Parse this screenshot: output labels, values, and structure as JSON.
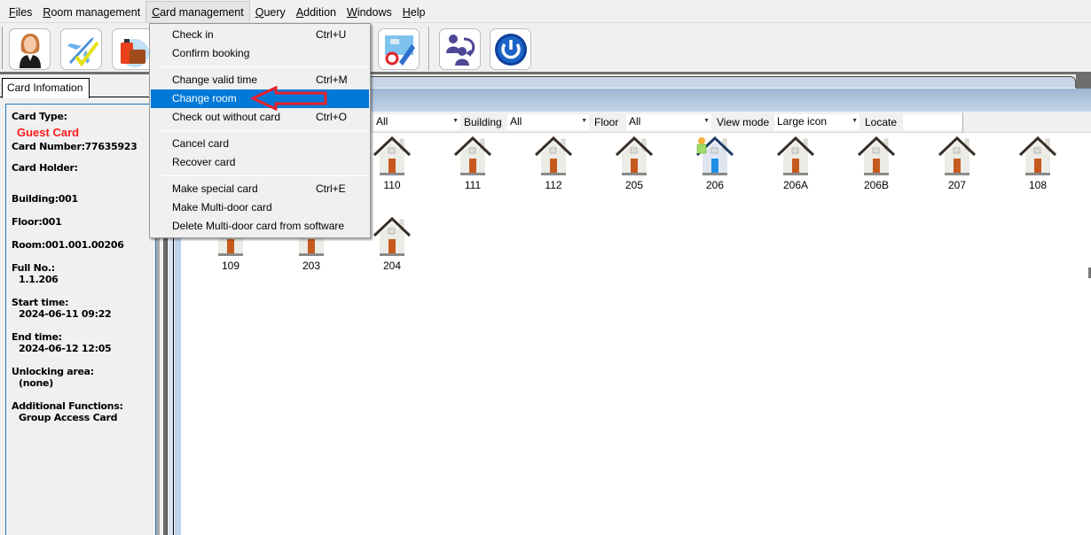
{
  "menubar": {
    "items": [
      {
        "label": "Files",
        "accel": "F",
        "rest": "iles"
      },
      {
        "label": "Room management",
        "accel": "R",
        "rest": "oom management"
      },
      {
        "label": "Card management",
        "accel": "C",
        "rest": "ard management",
        "open": true
      },
      {
        "label": "Query",
        "accel": "Q",
        "rest": "uery"
      },
      {
        "label": "Addition",
        "accel": "A",
        "rest": "ddition"
      },
      {
        "label": "Windows",
        "accel": "W",
        "rest": "indows"
      },
      {
        "label": "Help",
        "accel": "H",
        "rest": "elp"
      }
    ]
  },
  "toolbar": {
    "buttons": [
      {
        "name": "staff",
        "icon": "receptionist-icon"
      },
      {
        "name": "check-in",
        "icon": "airplane-check-icon"
      },
      {
        "name": "luggage",
        "icon": "luggage-icon"
      },
      {
        "name": "edit-card",
        "icon": "edit-refresh-icon"
      },
      {
        "name": "switch-user",
        "icon": "switch-user-icon"
      },
      {
        "name": "exit",
        "icon": "power-icon"
      }
    ]
  },
  "card_menu": {
    "items": [
      {
        "label": "Check in",
        "shortcut": "Ctrl+U"
      },
      {
        "label": "Confirm booking",
        "shortcut": ""
      },
      {
        "separator": true
      },
      {
        "label": "Change valid time",
        "shortcut": "Ctrl+M"
      },
      {
        "label": "Change room",
        "shortcut": "",
        "highlighted": true
      },
      {
        "label": "Check out without card",
        "shortcut": "Ctrl+O"
      },
      {
        "separator": true
      },
      {
        "label": "Cancel card",
        "shortcut": ""
      },
      {
        "label": "Recover card",
        "shortcut": ""
      },
      {
        "separator": true
      },
      {
        "label": "Make special card",
        "shortcut": "Ctrl+E"
      },
      {
        "label": "Make Multi-door card",
        "shortcut": ""
      },
      {
        "label": "Delete Multi-door card from software",
        "shortcut": ""
      }
    ]
  },
  "card_info": {
    "tab_label": "Card Infomation",
    "card_type_label": "Card Type:",
    "card_type_value": "Guest Card",
    "card_number": "Card Number:77635923",
    "card_holder_label": "Card Holder:",
    "building": "Building:001",
    "floor": "Floor:001",
    "room": "Room:001.001.00206",
    "full_no_label": "Full No.:",
    "full_no_value": "1.1.206",
    "start_time_label": "Start time:",
    "start_time_value": "2024-06-11 09:22",
    "end_time_label": "End time:",
    "end_time_value": "2024-06-12 12:05",
    "unlocking_area_label": "Unlocking area:",
    "unlocking_area_value": "(none)",
    "additional_label": "Additional Functions:",
    "additional_value": "Group Access Card"
  },
  "filters": {
    "first_value": "All",
    "building_label": "Building",
    "building_value": "All",
    "floor_label": "Floor",
    "floor_value": "All",
    "view_mode_label": "View mode",
    "view_mode_value": "Large icon",
    "locate_label": "Locate",
    "locate_value": ""
  },
  "rooms": {
    "row1": [
      {
        "label": "",
        "occupied": false,
        "hidden": true
      },
      {
        "label": "",
        "occupied": false,
        "hidden": true
      },
      {
        "label": "110",
        "occupied": false
      },
      {
        "label": "111",
        "occupied": false
      },
      {
        "label": "112",
        "occupied": false
      },
      {
        "label": "205",
        "occupied": false
      },
      {
        "label": "206",
        "occupied": true
      },
      {
        "label": "206A",
        "occupied": false
      },
      {
        "label": "206B",
        "occupied": false
      },
      {
        "label": "207",
        "occupied": false
      },
      {
        "label": "108",
        "occupied": false
      }
    ],
    "row2": [
      {
        "label": "109",
        "occupied": false
      },
      {
        "label": "203",
        "occupied": false
      },
      {
        "label": "204",
        "occupied": false
      }
    ]
  },
  "colors": {
    "highlight": "#0078d7",
    "guest_card": "#ff1a1a",
    "annotation_arrow": "#e8202a",
    "panel_border": "#1c79c9"
  }
}
